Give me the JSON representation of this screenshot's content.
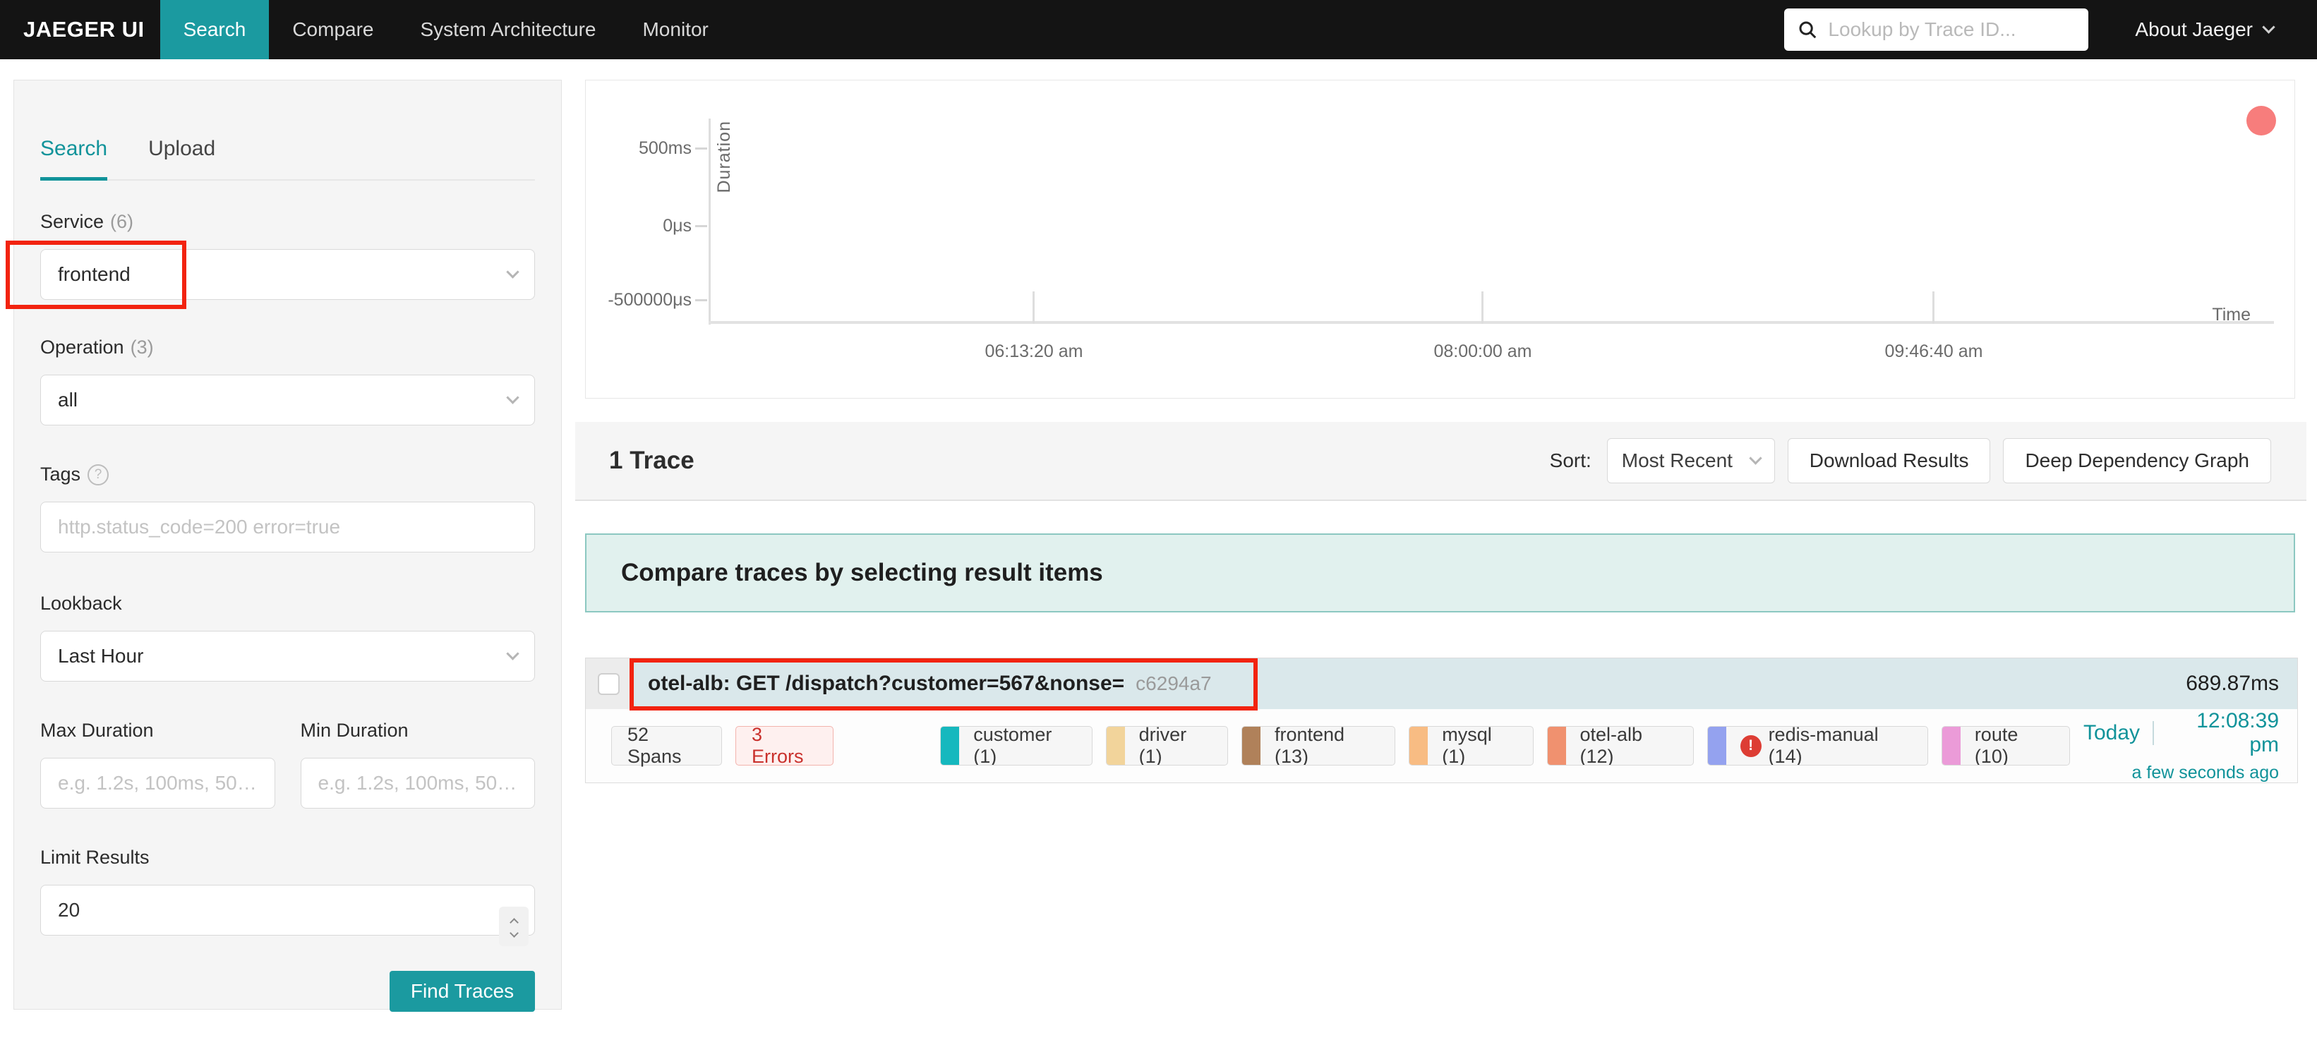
{
  "navbar": {
    "brand": "JAEGER UI",
    "tabs": [
      {
        "label": "Search",
        "active": true
      },
      {
        "label": "Compare",
        "active": false
      },
      {
        "label": "System Architecture",
        "active": false
      },
      {
        "label": "Monitor",
        "active": false
      }
    ],
    "trace_lookup_placeholder": "Lookup by Trace ID...",
    "about_label": "About Jaeger"
  },
  "sidebar": {
    "tabs": [
      {
        "label": "Search",
        "active": true
      },
      {
        "label": "Upload",
        "active": false
      }
    ],
    "service": {
      "label": "Service",
      "count": "(6)",
      "value": "frontend"
    },
    "operation": {
      "label": "Operation",
      "count": "(3)",
      "value": "all"
    },
    "tags": {
      "label": "Tags",
      "placeholder": "http.status_code=200 error=true"
    },
    "lookback": {
      "label": "Lookback",
      "value": "Last Hour"
    },
    "max_duration": {
      "label": "Max Duration",
      "placeholder": "e.g. 1.2s, 100ms, 500..."
    },
    "min_duration": {
      "label": "Min Duration",
      "placeholder": "e.g. 1.2s, 100ms, 500..."
    },
    "limit": {
      "label": "Limit Results",
      "value": "20"
    },
    "find_traces_label": "Find Traces"
  },
  "chart": {
    "ylabel": "Duration",
    "xlabel": "Time",
    "y_ticks": [
      "500ms",
      "0μs",
      "-500000μs"
    ],
    "x_ticks": [
      "06:13:20 am",
      "08:00:00 am",
      "09:46:40 am"
    ],
    "point_color": "#f77d7c"
  },
  "chart_data": {
    "type": "scatter",
    "title": "",
    "xlabel": "Time",
    "ylabel": "Duration",
    "x_tick_labels": [
      "06:13:20 am",
      "08:00:00 am",
      "09:46:40 am"
    ],
    "y_tick_labels": [
      "500ms",
      "0μs",
      "-500000μs"
    ],
    "points": [
      {
        "time": "12:08:39 pm",
        "duration": "689.87ms",
        "color": "#f77d7c",
        "trace": "otel-alb: GET /dispatch?customer=567&nonse= c6294a7"
      }
    ],
    "legend": false,
    "grid": false
  },
  "results": {
    "count_label": "1 Trace",
    "sort_label": "Sort:",
    "sort_value": "Most Recent",
    "download_label": "Download Results",
    "ddg_label": "Deep Dependency Graph",
    "compare_banner": "Compare traces by selecting result items"
  },
  "trace": {
    "title": "otel-alb: GET /dispatch?customer=567&nonse=",
    "short_id": "c6294a7",
    "duration": "689.87ms",
    "spans_label": "52 Spans",
    "errors_label": "3 Errors",
    "services": [
      {
        "name": "customer (1)",
        "color": "#16b8be",
        "error": false
      },
      {
        "name": "driver (1)",
        "color": "#f2d49b",
        "error": false
      },
      {
        "name": "frontend (13)",
        "color": "#b0815a",
        "error": false
      },
      {
        "name": "mysql (1)",
        "color": "#f8bc83",
        "error": false
      },
      {
        "name": "otel-alb (12)",
        "color": "#f0916f",
        "error": false
      },
      {
        "name": "redis-manual (14)",
        "color": "#94a2ef",
        "error": true
      },
      {
        "name": "route (10)",
        "color": "#eb9bd8",
        "error": false
      }
    ],
    "date": "Today",
    "time": "12:08:39 pm",
    "relative_time": "a few seconds ago"
  },
  "icons": {
    "search": "magnifier",
    "chevron_down": "caret",
    "help": "?",
    "error_badge": "!"
  },
  "colors": {
    "accent_fill": "#1b9aa0",
    "accent_text": "#11939a",
    "navbar_bg": "#141414",
    "trace_header_bg": "#dae8eb",
    "banner_bg": "#e1f1ee",
    "banner_border": "#8cc8c1",
    "annotation_red": "#f2230f",
    "scatter_point": "#f77d7c"
  },
  "annotations": [
    {
      "target": "service-select"
    },
    {
      "target": "trace-title"
    }
  ]
}
